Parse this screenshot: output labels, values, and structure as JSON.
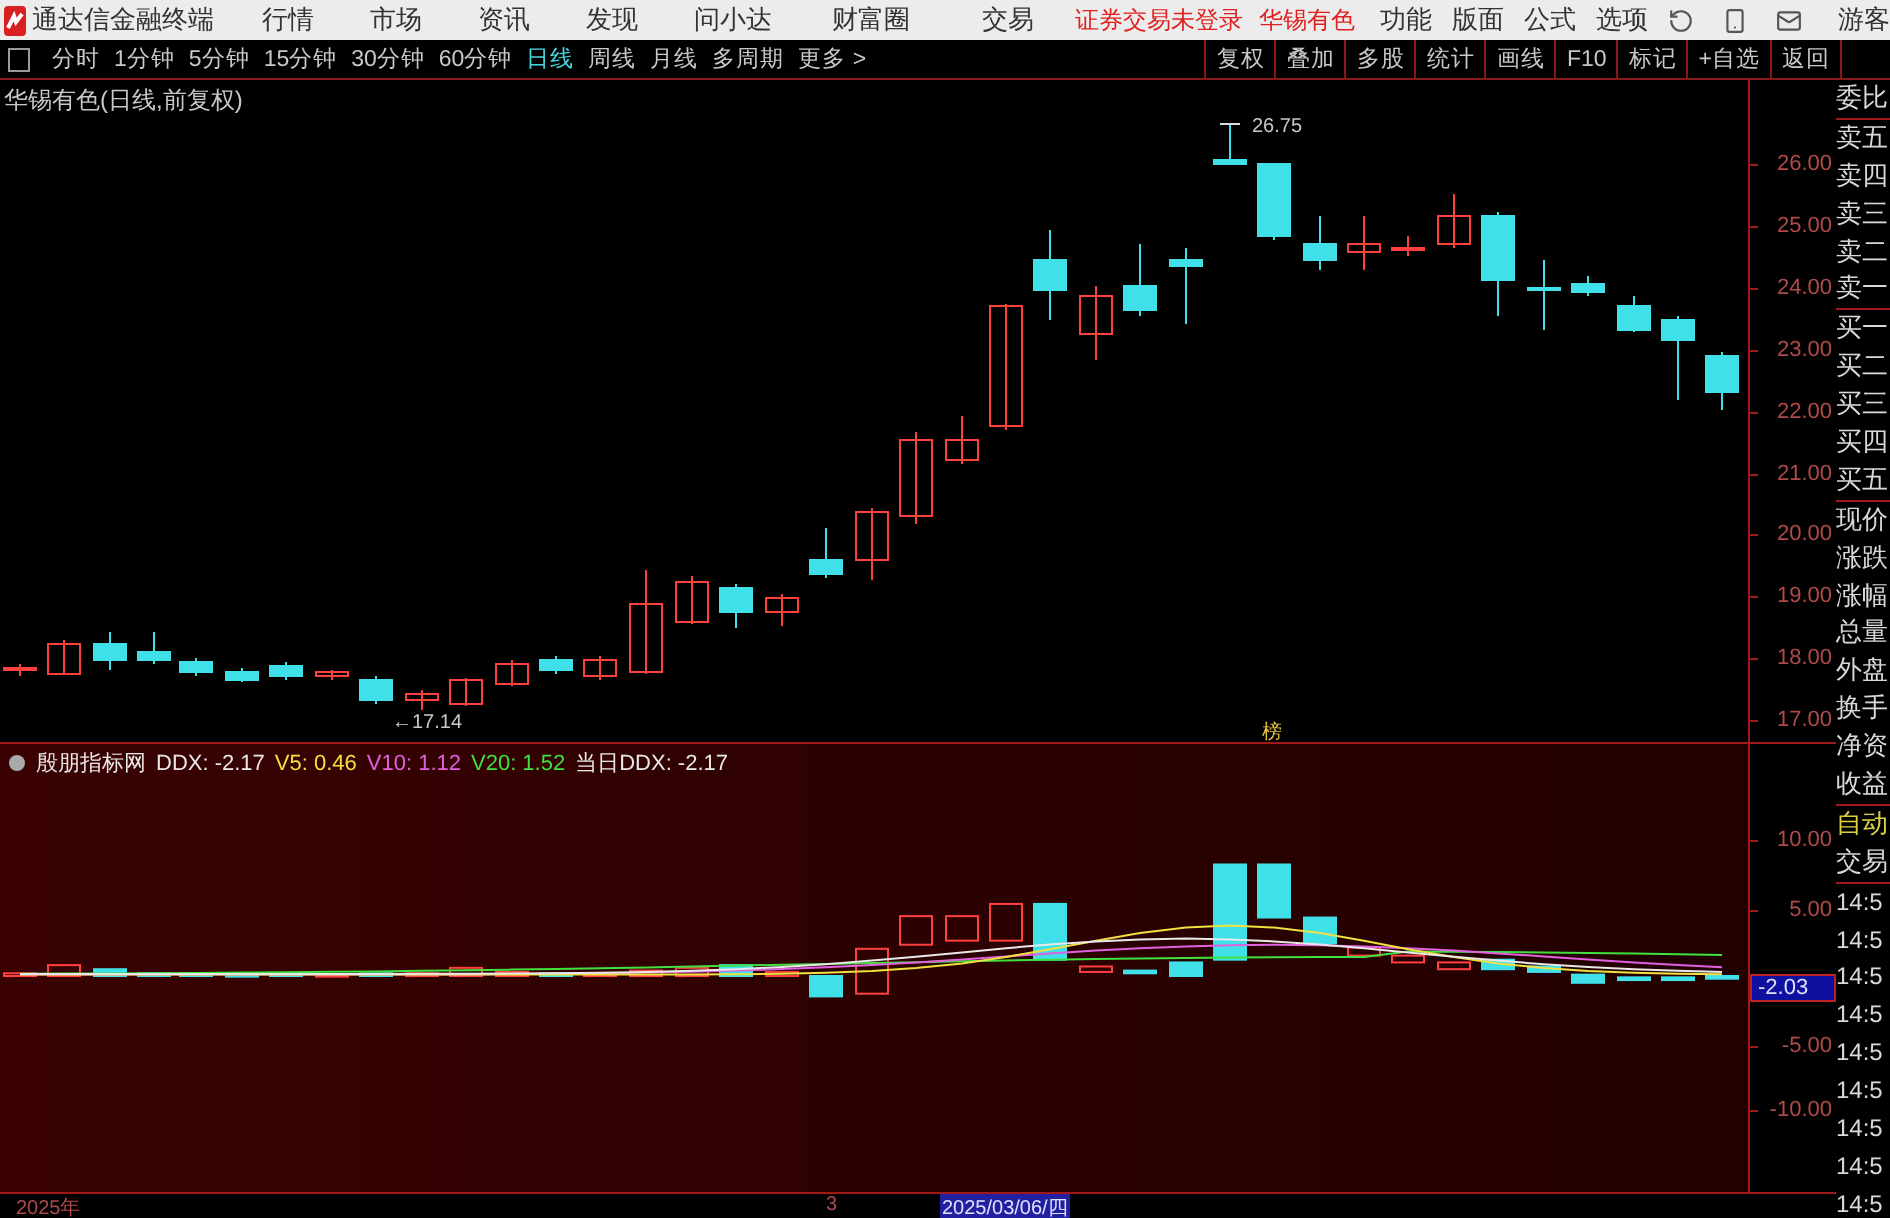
{
  "app": {
    "title": "通达信金融终端"
  },
  "menu": [
    "行情",
    "市场",
    "资讯",
    "发现",
    "问小达",
    "财富圈",
    "交易"
  ],
  "status": [
    "证券交易未登录",
    "华锡有色"
  ],
  "tools": [
    "功能",
    "版面",
    "公式",
    "选项"
  ],
  "user": "游客",
  "periods": [
    {
      "label": "分时",
      "selected": false
    },
    {
      "label": "1分钟",
      "selected": false
    },
    {
      "label": "5分钟",
      "selected": false
    },
    {
      "label": "15分钟",
      "selected": false
    },
    {
      "label": "30分钟",
      "selected": false
    },
    {
      "label": "60分钟",
      "selected": false
    },
    {
      "label": "日线",
      "selected": true
    },
    {
      "label": "周线",
      "selected": false
    },
    {
      "label": "月线",
      "selected": false
    },
    {
      "label": "多周期",
      "selected": false
    },
    {
      "label": "更多 >",
      "selected": false
    }
  ],
  "actions": [
    "复权",
    "叠加",
    "多股",
    "统计",
    "画线",
    "F10",
    "标记",
    "+自选",
    "返回"
  ],
  "chart": {
    "title": "华锡有色(日线,前复权)",
    "price_ticks": [
      "26.00",
      "25.00",
      "24.00",
      "23.00",
      "22.00",
      "21.00",
      "20.00",
      "19.00",
      "18.00",
      "17.00"
    ],
    "high_label": "26.75",
    "low_label": "←17.14",
    "marker": "榜"
  },
  "indicator": {
    "name": "殷朋指标网",
    "legend": [
      {
        "label": "DDX: -2.17",
        "color": "#e8e8e8"
      },
      {
        "label": "V5: 0.46",
        "color": "#f0e040"
      },
      {
        "label": "V10: 1.12",
        "color": "#e060e0"
      },
      {
        "label": "V20: 1.52",
        "color": "#40e040"
      },
      {
        "label": "当日DDX: -2.17",
        "color": "#e8e8e8"
      }
    ],
    "ticks": [
      "10.00",
      "5.00",
      "-5.00",
      "-10.00"
    ],
    "current": "-2.03"
  },
  "date_axis": {
    "year": "2025年",
    "month": "3",
    "cursor": "2025/03/06/四"
  },
  "quote_panel": [
    [
      "委比"
    ],
    [
      "卖五",
      "卖四",
      "卖三",
      "卖二",
      "卖一"
    ],
    [
      "买一",
      "买二",
      "买三",
      "买四",
      "买五"
    ],
    [
      "现价",
      "涨跌",
      "涨幅",
      "总量",
      "外盘",
      "换手",
      "净资",
      "收益"
    ]
  ],
  "trade_panel": {
    "labels": [
      "自动",
      "交易"
    ],
    "times": [
      "14:5",
      "14:5",
      "14:5",
      "14:5",
      "14:5",
      "14:5",
      "14:5",
      "14:5",
      "14:5"
    ]
  }
}
